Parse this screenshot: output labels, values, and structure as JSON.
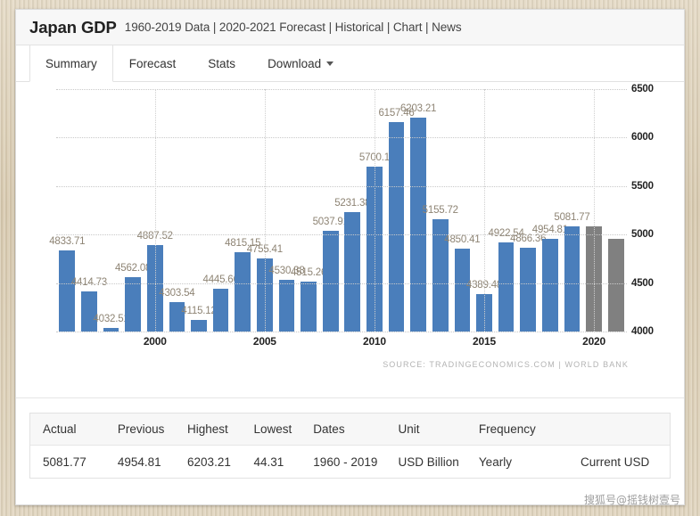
{
  "header": {
    "title": "Japan GDP",
    "subtitle": "1960-2019 Data | 2020-2021 Forecast | Historical | Chart | News"
  },
  "tabs": [
    {
      "label": "Summary",
      "active": true
    },
    {
      "label": "Forecast",
      "active": false
    },
    {
      "label": "Stats",
      "active": false
    },
    {
      "label": "Download",
      "active": false,
      "caret": true
    }
  ],
  "source_note": "SOURCE: TRADINGECONOMICS.COM | WORLD BANK",
  "stats": {
    "headers": [
      "Actual",
      "Previous",
      "Highest",
      "Lowest",
      "Dates",
      "Unit",
      "Frequency",
      ""
    ],
    "values": [
      "5081.77",
      "4954.81",
      "6203.21",
      "44.31",
      "1960 - 2019",
      "USD Billion",
      "Yearly",
      "Current USD"
    ]
  },
  "watermark": "搜狐号@摇钱树壹号",
  "chart_data": {
    "type": "bar",
    "title": "",
    "xlabel": "",
    "ylabel": "",
    "ylim": [
      4000,
      6500
    ],
    "yticks": [
      4000,
      4500,
      5000,
      5500,
      6000,
      6500
    ],
    "xticks": [
      "2000",
      "2005",
      "2010",
      "2015",
      "2020"
    ],
    "grid": true,
    "legend": "none",
    "bar_color": "#4a7ebb",
    "forecast_color": "#808080",
    "categories": [
      "1996",
      "1997",
      "1998",
      "1999",
      "2000",
      "2001",
      "2002",
      "2003",
      "2004",
      "2005",
      "2006",
      "2007",
      "2008",
      "2009",
      "2010",
      "2011",
      "2012",
      "2013",
      "2014",
      "2015",
      "2016",
      "2017",
      "2018",
      "2019",
      "2020",
      "2021"
    ],
    "values": [
      4833.71,
      4414.73,
      4032.51,
      4562.08,
      4887.52,
      4303.54,
      4115.12,
      4445.66,
      4815.15,
      4755.41,
      4530.38,
      4515.26,
      5037.91,
      5231.38,
      5700.1,
      6157.46,
      6203.21,
      5155.72,
      4850.41,
      4389.48,
      4922.54,
      4866.36,
      4954.81,
      5081.77,
      5081.77,
      4954.81
    ],
    "labels": [
      "4833.71",
      "4414.73",
      "4032.51",
      "4562.08",
      "4887.52",
      "4303.54",
      "4115.12",
      "4445.66",
      "4815.15",
      "4755.41",
      "4530.38",
      "4515.26",
      "5037.91",
      "5231.38",
      "5700.1",
      "6157.46",
      "6203.21",
      "5155.72",
      "4850.41",
      "4389.48",
      "4922.54",
      "4866.36",
      "4954.81",
      "5081.77",
      "",
      ""
    ],
    "forecast_from": "2020"
  }
}
